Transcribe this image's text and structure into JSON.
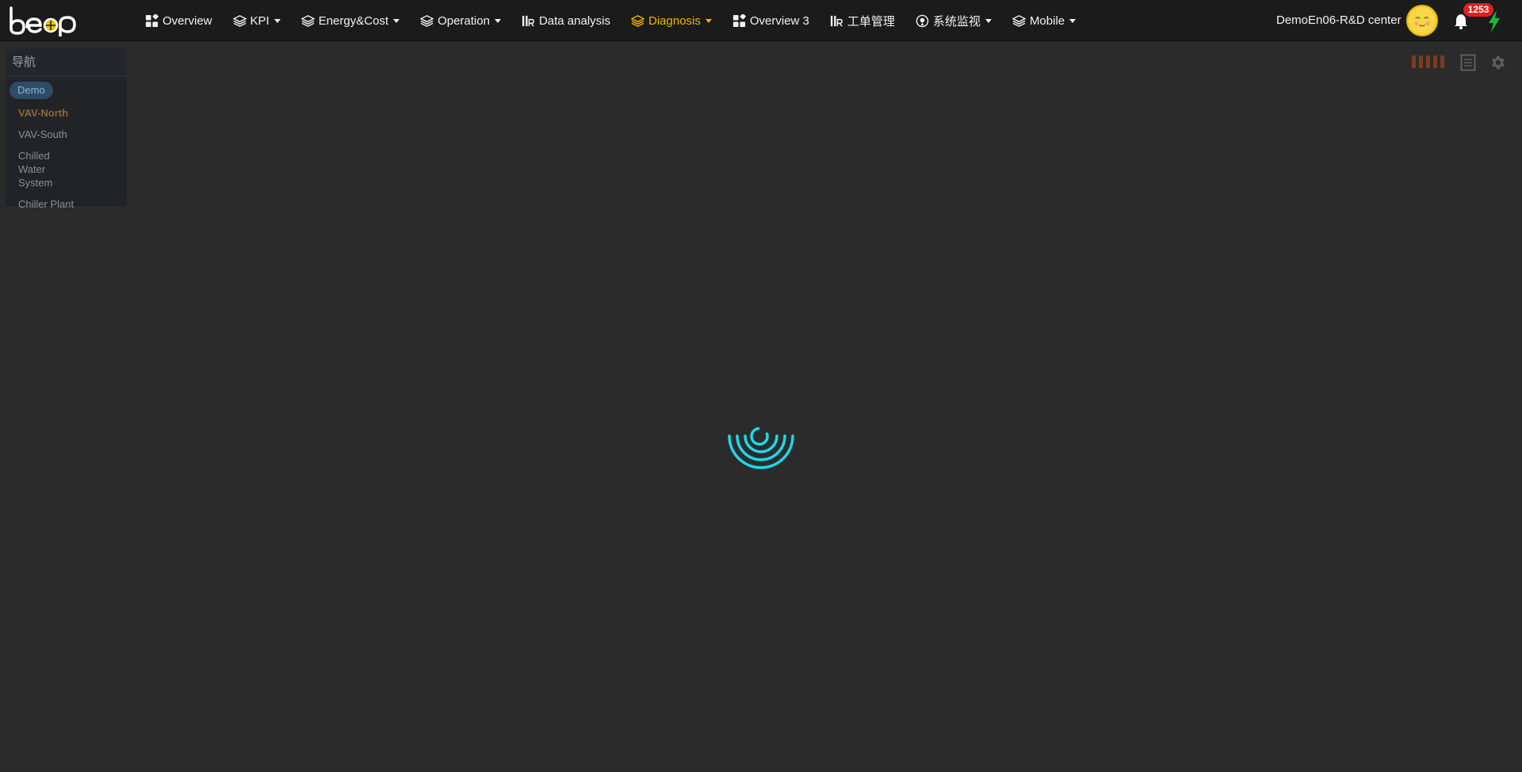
{
  "app": {
    "logo_text": "beep"
  },
  "nav": {
    "items": [
      {
        "label": "Overview",
        "icon": "dashboard-icon",
        "dropdown": false,
        "active": false
      },
      {
        "label": "KPI",
        "icon": "layers-icon",
        "dropdown": true,
        "active": false
      },
      {
        "label": "Energy&Cost",
        "icon": "layers-icon",
        "dropdown": true,
        "active": false
      },
      {
        "label": "Operation",
        "icon": "layers-icon",
        "dropdown": true,
        "active": false
      },
      {
        "label": "Data analysis",
        "icon": "analysis-icon",
        "dropdown": false,
        "active": false
      },
      {
        "label": "Diagnosis",
        "icon": "layers-icon",
        "dropdown": true,
        "active": true
      },
      {
        "label": "Overview 3",
        "icon": "dashboard-icon",
        "dropdown": false,
        "active": false
      },
      {
        "label": "工单管理",
        "icon": "analysis-icon",
        "dropdown": false,
        "active": false
      },
      {
        "label": "系统监视",
        "icon": "monitor-icon",
        "dropdown": true,
        "active": false
      },
      {
        "label": "Mobile",
        "icon": "layers-icon",
        "dropdown": true,
        "active": false
      }
    ]
  },
  "user": {
    "name": "DemoEn06-R&D center",
    "notification_count": "1253"
  },
  "sidebar": {
    "title": "导航",
    "project": "Demo",
    "items": [
      {
        "label": "VAV-North",
        "selected": true
      },
      {
        "label": "VAV-South",
        "selected": false
      },
      {
        "label": "Chilled Water System",
        "selected": false
      },
      {
        "label": "Chiller Plant",
        "selected": false
      }
    ]
  },
  "colors": {
    "active_nav": "#f5b400",
    "spinner": "#1ed8e8",
    "badge": "#e02020",
    "bolt": "#1db83a",
    "tool_bars": "#7a3b1f"
  }
}
